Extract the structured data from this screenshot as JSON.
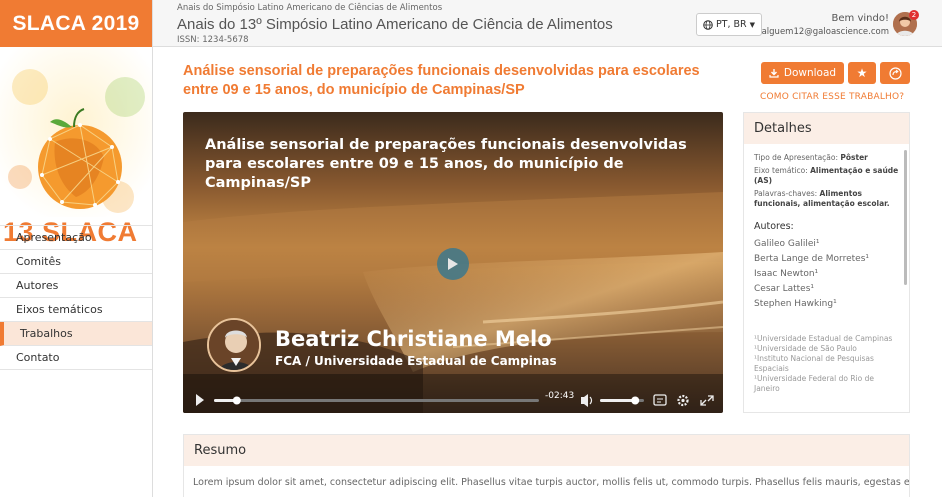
{
  "sidebar": {
    "brand": "SLACA 2019",
    "logo_text": "13 SLACA",
    "nav": [
      {
        "label": "Apresentação"
      },
      {
        "label": "Comitês"
      },
      {
        "label": "Autores"
      },
      {
        "label": "Eixos temáticos"
      },
      {
        "label": "Trabalhos",
        "active": true
      },
      {
        "label": "Contato"
      }
    ]
  },
  "header": {
    "subtitle": "Anais do Simpósio Latino Americano de Ciências de Alimentos",
    "title": "Anais do 13º Simpósio Latino Americano de Ciência de Alimentos",
    "issn": "ISSN: 1234-5678",
    "language": "PT, BR",
    "welcome": "Bem vindo!",
    "email": "alguem12@galoascience.com",
    "notification_count": "2"
  },
  "paper": {
    "title": "Análise sensorial de preparações funcionais desenvolvidas para escolares entre 09 e 15 anos, do município de Campinas/SP",
    "download_label": "Download",
    "cite_label": "COMO CITAR ESSE TRABALHO?"
  },
  "video": {
    "title": "Análise sensorial de preparações funcionais desenvolvidas para escolares entre 09 e 15 anos, do município de Campinas/SP",
    "speaker": "Beatriz Christiane Melo",
    "institution": "FCA / Universidade Estadual de Campinas",
    "time_remaining": "-02:43",
    "progress": 0.07,
    "volume": 0.8
  },
  "details": {
    "heading": "Detalhes",
    "presentation_label": "Tipo de Apresentação:",
    "presentation_value": "Pôster",
    "axis_label": "Eixo temático:",
    "axis_value": "Alimentação e saúde (AS)",
    "keywords_label": "Palavras-chaves:",
    "keywords_value": "Alimentos funcionais, alimentação escolar.",
    "authors_label": "Autores:",
    "authors": [
      "Galileo Galilei¹",
      "Berta Lange de Morretes¹",
      "Isaac Newton¹",
      "Cesar Lattes¹",
      "Stephen Hawking¹"
    ],
    "affiliations": [
      "¹Universidade Estadual de Campinas",
      "¹Universidade de São Paulo",
      "¹Instituto Nacional de Pesquisas Espaciais",
      "¹Universidade Federal do Rio de Janeiro"
    ]
  },
  "resumo": {
    "heading": "Resumo",
    "text": "Lorem ipsum dolor sit amet, consectetur adipiscing elit. Phasellus vitae turpis auctor, mollis felis ut, commodo turpis. Phasellus felis mauris, egestas eget"
  },
  "colors": {
    "accent": "#f07b33",
    "panel_header": "#fbeee6"
  },
  "icons": [
    "globe-icon",
    "caret-down-icon",
    "download-icon",
    "star-icon",
    "share-icon",
    "play-icon",
    "volume-icon",
    "captions-icon",
    "settings-icon",
    "fullscreen-icon"
  ]
}
